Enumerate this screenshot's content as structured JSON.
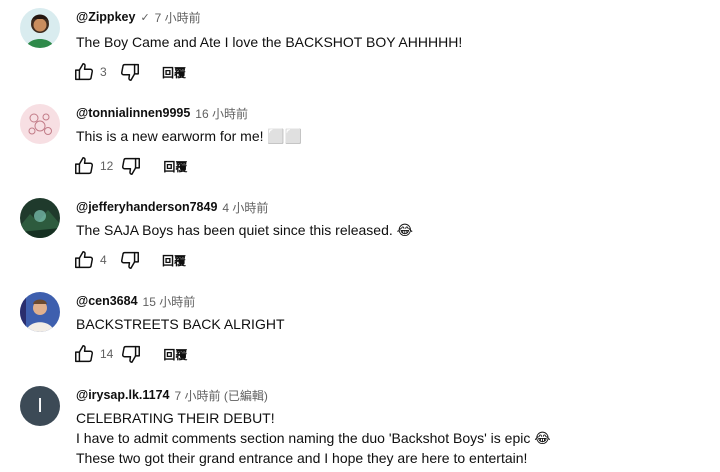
{
  "comments": [
    {
      "handle": "@Zippkey",
      "verified_mark": "✓",
      "time": "7 小時前",
      "lines": [
        "The Boy Came and Ate I love the BACKSHOT BOY AHHHHH!"
      ],
      "likes": "3",
      "reply_label": "回覆",
      "avatar_icon": "cartoon-avatar"
    },
    {
      "handle": "@tonnialinnen9995",
      "time": "16 小時前",
      "lines": [
        "This is a new earworm for me! ⬜⬜"
      ],
      "likes": "12",
      "reply_label": "回覆",
      "avatar_icon": "pink-doodle-avatar"
    },
    {
      "handle": "@jefferyhanderson7849",
      "time": "4 小時前",
      "lines": [
        "The SAJA Boys has been quiet since this released. 😂"
      ],
      "likes": "4",
      "reply_label": "回覆",
      "avatar_icon": "forest-avatar"
    },
    {
      "handle": "@cen3684",
      "time": "15 小時前",
      "lines": [
        "BACKSTREETS BACK ALRIGHT"
      ],
      "likes": "14",
      "reply_label": "回覆",
      "avatar_icon": "photo-avatar"
    },
    {
      "handle": "@irysap.lk.1174",
      "time": "7 小時前 (已編輯)",
      "avatar_letter": "I",
      "lines": [
        "CELEBRATING THEIR DEBUT!",
        "I have to admit comments section naming the duo 'Backshot Boys' is epic 😂",
        "These two got their grand entrance and I hope they are here to entertain!"
      ]
    }
  ],
  "colors": {
    "text_primary": "#0f0f0f",
    "text_secondary": "#606060",
    "letter_avatar_bg": "#3c4a56"
  },
  "icons": [
    "thumbs-up-icon",
    "thumbs-down-icon"
  ]
}
